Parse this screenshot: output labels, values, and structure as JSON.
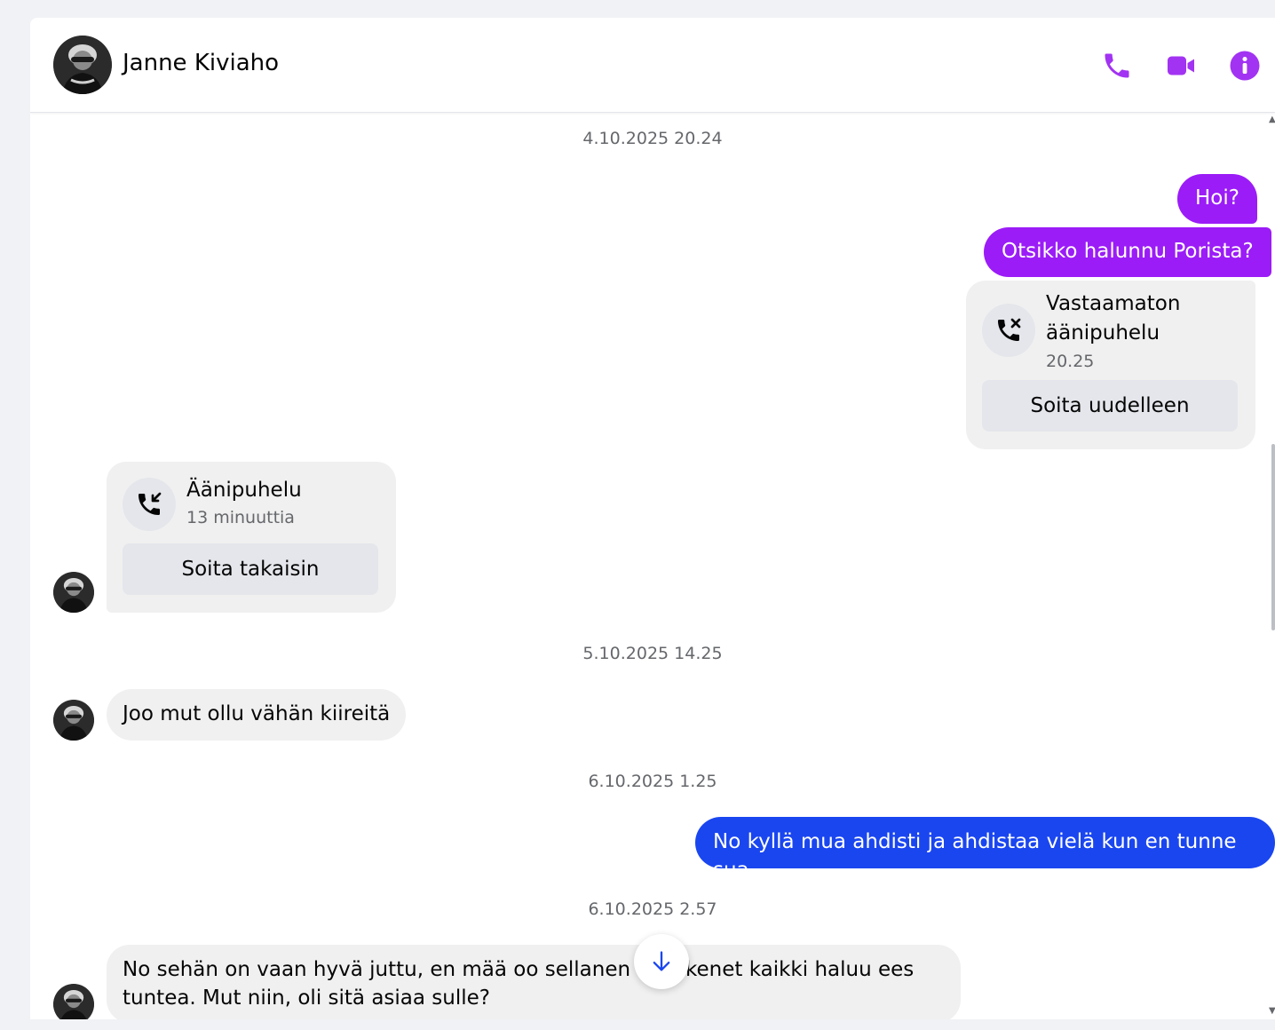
{
  "header": {
    "contact_name": "Janne Kiviaho",
    "icons": [
      "phone-icon",
      "video-icon",
      "info-icon"
    ],
    "accent_color": "#a233f2"
  },
  "messages": [
    {
      "type": "timestamp",
      "text": "4.10.2025 20.24"
    },
    {
      "type": "outgoing",
      "text": "Hoi?",
      "color": "#9b1cf7"
    },
    {
      "type": "outgoing",
      "text": "Otsikko halunnu Porista?",
      "color": "#9b1cf7"
    },
    {
      "type": "call",
      "direction": "outgoing",
      "title": "Vastaamaton äänipuhelu",
      "title_line1": "Vastaamaton",
      "title_line2": "äänipuhelu",
      "subtitle": "20.25",
      "button": "Soita uudelleen",
      "icon": "missed-call-icon"
    },
    {
      "type": "call",
      "direction": "incoming",
      "title": "Äänipuhelu",
      "subtitle": "13 minuuttia",
      "button": "Soita takaisin",
      "icon": "incoming-call-icon"
    },
    {
      "type": "timestamp",
      "text": "5.10.2025 14.25"
    },
    {
      "type": "incoming",
      "text": "Joo mut ollu vähän kiireitä"
    },
    {
      "type": "timestamp",
      "text": "6.10.2025 1.25"
    },
    {
      "type": "outgoing",
      "text": "No kyllä mua ahdisti ja ahdistaa vielä kun en tunne sua",
      "color": "#1a46f0"
    },
    {
      "type": "timestamp",
      "text": "6.10.2025 2.57"
    },
    {
      "type": "incoming",
      "text_line1_a": "No sehän on vaan hyvä juttu, en mää oo sellanen ihm",
      "text_line1_b": "kenet kaikki haluu ees",
      "text_line2": "tuntea. Mut niin, oli sitä asiaa sulle?"
    }
  ],
  "jump_button": {
    "icon": "arrow-down-icon"
  }
}
